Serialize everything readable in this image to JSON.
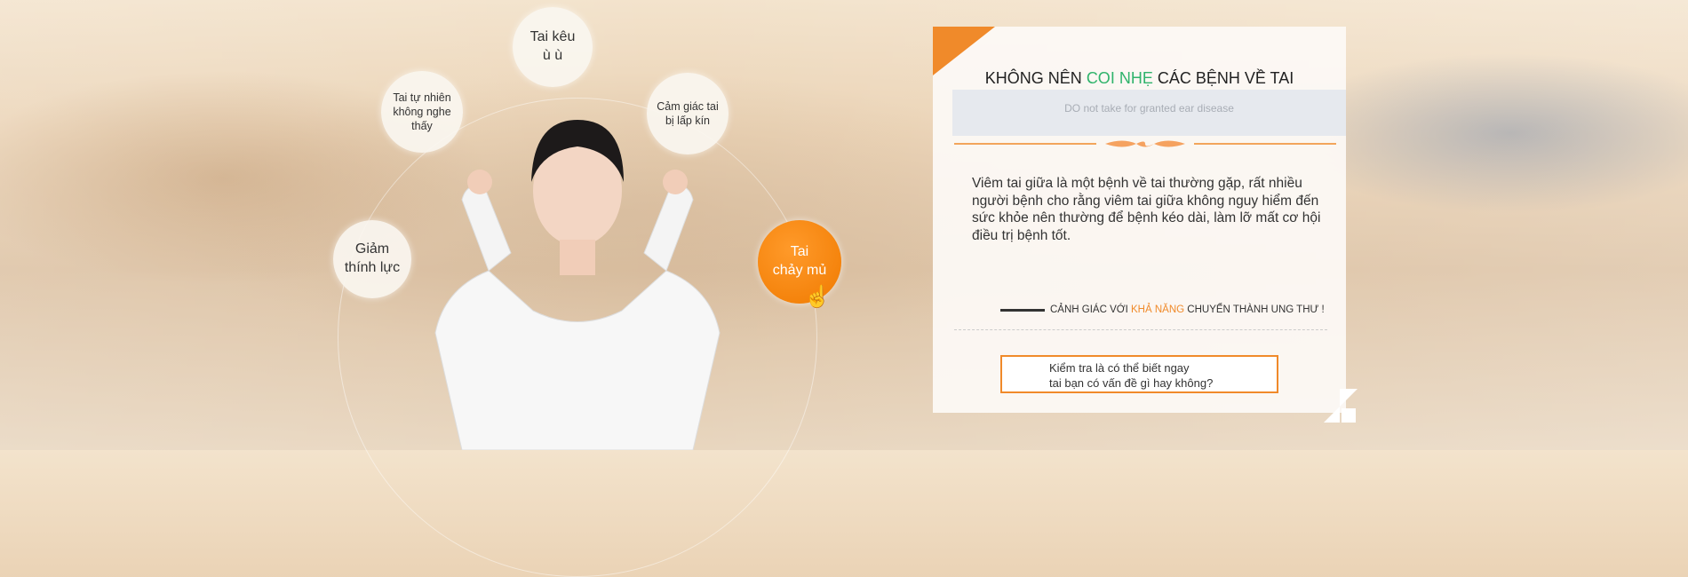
{
  "bubbles": [
    {
      "label": "Tai kêu\nù ù"
    },
    {
      "label": "Tai tự nhiên\nkhông nghe\nthấy"
    },
    {
      "label": "Cảm giác tai\nbị lấp kín"
    },
    {
      "label": "Giảm\nthính lực"
    },
    {
      "label": "Tai\nchảy mủ"
    }
  ],
  "panel": {
    "title_pre": "KHÔNG NÊN ",
    "title_highlight": "COI NHẸ",
    "title_post": " CÁC BỆNH VỀ TAI",
    "subtitle": "DO not take for granted ear disease",
    "paragraph": "Viêm tai giữa là một bệnh về tai thường gặp, rất nhiều người bệnh cho rằng viêm tai giữa không nguy hiểm đến sức khỏe nên thường để bệnh kéo dài, làm lỡ mất cơ hội điều trị bệnh tốt.",
    "warning_pre": "CẢNH GIÁC VỚI ",
    "warning_highlight": "KHẢ NĂNG",
    "warning_post": " CHUYỂN THÀNH UNG THƯ !",
    "cta": "Kiểm tra là có thể biết ngay\ntai bạn có vấn đề gì hay không?"
  },
  "colors": {
    "accent": "#f08a2a",
    "highlight": "#2fb36b"
  }
}
